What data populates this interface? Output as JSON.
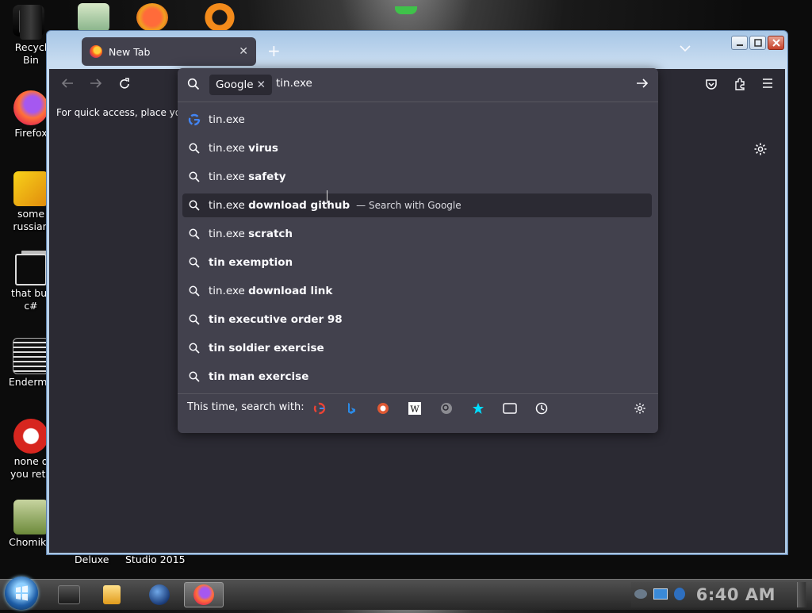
{
  "desktop": {
    "icons": [
      {
        "id": "recycle-bin",
        "label": "Recycl\nBin",
        "lines": [
          "Recycl",
          "Bin"
        ]
      },
      {
        "id": "firefox",
        "lines": [
          "Firefox"
        ]
      },
      {
        "id": "some-russian",
        "lines": [
          "some",
          "russian"
        ]
      },
      {
        "id": "that-but-csharp",
        "lines": [
          "that but",
          "c#"
        ]
      },
      {
        "id": "enderman",
        "lines": [
          "Enderma"
        ]
      },
      {
        "id": "none-of-you",
        "lines": [
          "none o",
          "you reta"
        ]
      },
      {
        "id": "chomik",
        "lines": [
          "ChomikB"
        ]
      }
    ],
    "captions": [
      "Deluxe",
      "Studio 2015"
    ]
  },
  "browser": {
    "tab_title": "New Tab",
    "tab_close": "✕",
    "new_tab": "+",
    "bookmarks_hint": "For quick access, place your b",
    "urlbar": {
      "engine": "Google",
      "engine_remove": "✕",
      "value": "tin.exe"
    },
    "results": [
      {
        "prefix": "tin.exe",
        "bold": "",
        "note": "",
        "icon": "google-icon"
      },
      {
        "prefix": "tin.exe",
        "bold": "virus",
        "note": "",
        "icon": "search-icon"
      },
      {
        "prefix": "tin.exe",
        "bold": "safety",
        "note": "",
        "icon": "search-icon"
      },
      {
        "prefix": "tin.exe",
        "bold": "download github",
        "note": "— Search with Google",
        "icon": "search-icon",
        "selected": true
      },
      {
        "prefix": "tin.exe",
        "bold": "scratch",
        "note": "",
        "icon": "search-icon"
      },
      {
        "prefix": "",
        "bold": "tin exemption",
        "note": "",
        "icon": "search-icon"
      },
      {
        "prefix": "tin.exe",
        "bold": "download link",
        "note": "",
        "icon": "search-icon"
      },
      {
        "prefix": "",
        "bold": "tin executive order 98",
        "note": "",
        "icon": "search-icon"
      },
      {
        "prefix": "",
        "bold": "tin soldier exercise",
        "note": "",
        "icon": "search-icon"
      },
      {
        "prefix": "",
        "bold": "tin man exercise",
        "note": "",
        "icon": "search-icon"
      }
    ],
    "one_off_label": "This time, search with:",
    "one_offs": [
      "google",
      "bing",
      "duckduckgo",
      "wikipedia",
      "search-engine",
      "bookmarks",
      "tabs",
      "history"
    ]
  },
  "taskbar": {
    "clock": "6:40 AM"
  },
  "colors": {
    "panel": "#42414d",
    "toolbar": "#2b2a33",
    "text": "#fbfbfe",
    "titlebar": "#b6cfe8"
  }
}
